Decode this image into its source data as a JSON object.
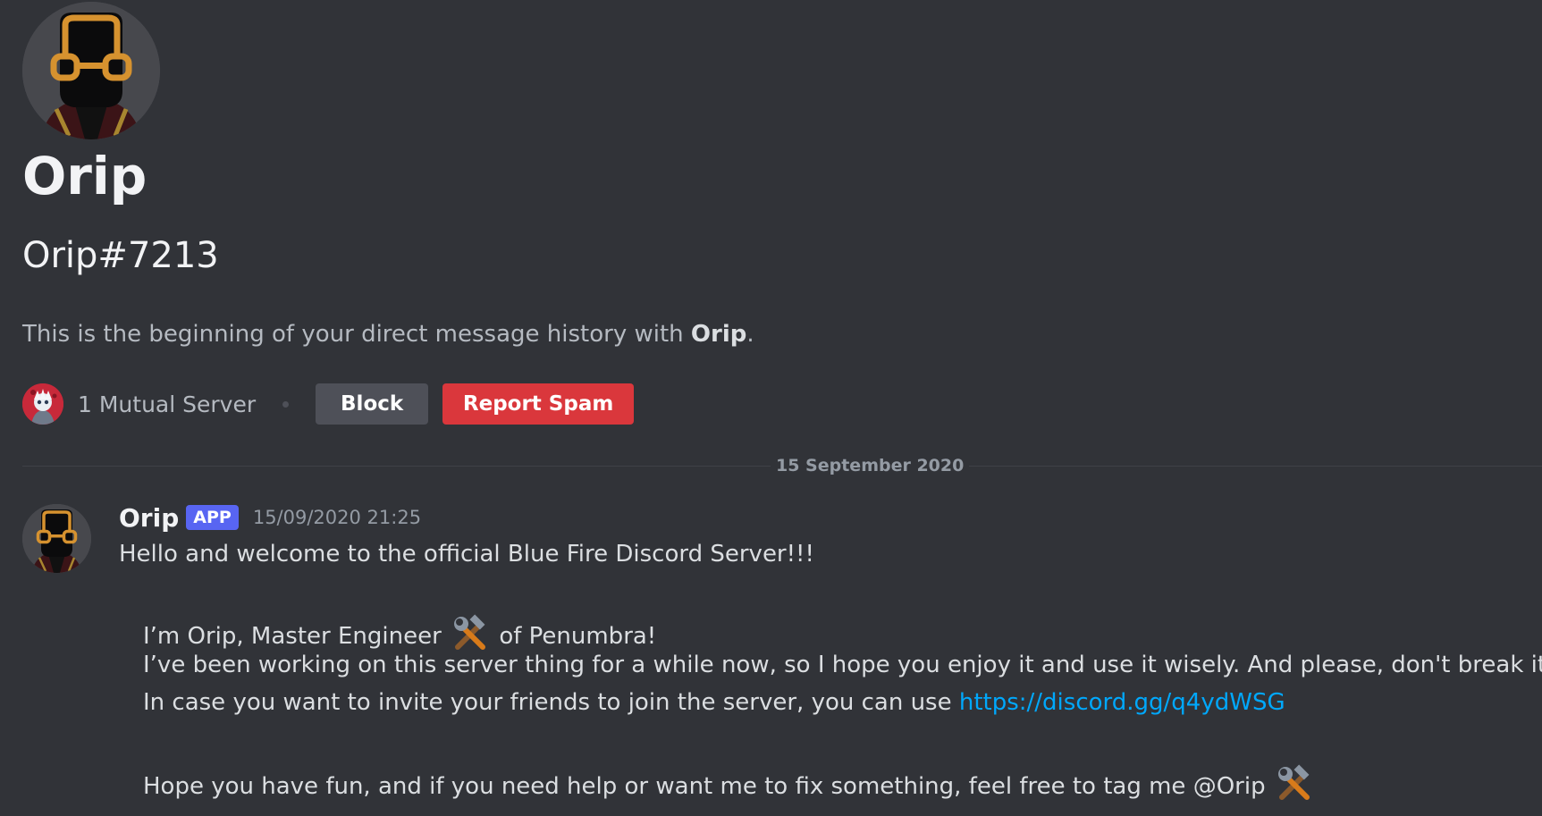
{
  "profile": {
    "display_name": "Orip",
    "username_tag": "Orip#7213",
    "history_prefix": "This is the beginning of your direct message history with ",
    "history_name": "Orip",
    "history_suffix": ".",
    "mutual_servers_label": "1 Mutual Server",
    "block_label": "Block",
    "report_spam_label": "Report Spam",
    "avatar_icon": "engineer-avatar-icon",
    "mutual_server_icon": "server-avatar-icon"
  },
  "divider": {
    "date_label": "15 September 2020"
  },
  "message": {
    "author": "Orip",
    "badge": "APP",
    "timestamp": "15/09/2020 21:25",
    "line_1": "Hello and welcome to the official Blue Fire Discord Server!!!",
    "line_2_prefix": "I’m Orip, Master Engineer",
    "line_2_suffix": "of Penumbra!",
    "line_3": "I’ve been working on this server thing for a while now, so I hope you enjoy it and use it wisely. And please, don't break it :).",
    "line_4_prefix": "In case you want to invite your friends to join the server, you can use ",
    "invite_link": "https://discord.gg/q4ydWSG",
    "line_5_prefix": "Hope you have fun, and if you need help or want me to fix something, feel free to tag me @Orip",
    "emoji_icon": "hammer-and-wrench-icon"
  },
  "colors": {
    "background": "#313338",
    "report_button": "#da373c",
    "block_button": "#4e5058",
    "app_badge": "#5865f2",
    "link": "#00a8fc"
  }
}
